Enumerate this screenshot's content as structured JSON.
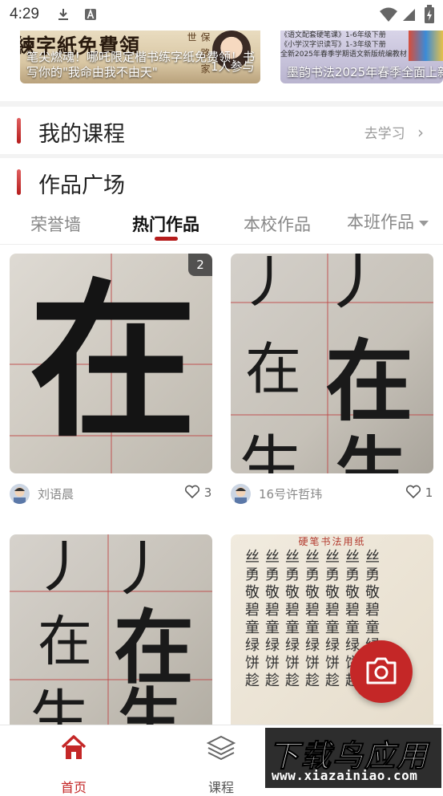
{
  "status_bar": {
    "time": "4:29"
  },
  "banners": [
    {
      "image_text": "練字紙免費領",
      "side_text": "保 路 家 世",
      "caption": "笔尖燃魂！哪吒限定楷书练字纸免费领！书写你的\"我命由我不由天\"",
      "overlay": "1人参与"
    },
    {
      "lines": [
        "《语文配套硬笔课》1-6年级下册",
        "《小学汉字识读写》1-3年级下册",
        "全新2025年春季学期语文新版统编教材"
      ],
      "caption": "墨韵书法2025年春季全面上新"
    }
  ],
  "my_courses": {
    "title": "我的课程",
    "link": "去学习",
    "chevron": "›"
  },
  "works_square": {
    "title": "作品广场"
  },
  "tabs": [
    {
      "label": "荣誉墙"
    },
    {
      "label": "热门作品"
    },
    {
      "label": "本校作品"
    },
    {
      "label": "本班作品"
    }
  ],
  "works": [
    {
      "author": "刘语晨",
      "likes": "3",
      "badge": "2",
      "glyphs": [
        "在"
      ]
    },
    {
      "author": "16号许哲玮",
      "likes": "1",
      "glyphs": [
        "丿",
        "丿",
        "在",
        "在",
        "生",
        "生"
      ]
    },
    {
      "glyphs": [
        "丿",
        "丿",
        "在",
        "在",
        "生",
        "生"
      ]
    },
    {
      "title": "硬笔书法用纸",
      "glyph_rows": [
        "丝丝丝丝丝丝丝",
        "勇勇勇勇勇勇勇",
        "敬敬敬敬敬敬敬",
        "碧碧碧碧碧碧碧",
        "童童童童童童童",
        "绿绿绿绿绿绿绿",
        "饼饼饼饼饼饼饼",
        "趁趁趁趁趁趁趁"
      ]
    }
  ],
  "bottom_nav": [
    {
      "label": "首页",
      "icon": "home-icon",
      "color": "#c42727"
    },
    {
      "label": "课程",
      "icon": "layers-icon",
      "color": "#555555"
    }
  ],
  "watermark": {
    "big": "下载鸟应用",
    "small": "www.xiazainiao.com"
  },
  "colors": {
    "accent": "#c42727",
    "underline": "#b51c1c"
  }
}
